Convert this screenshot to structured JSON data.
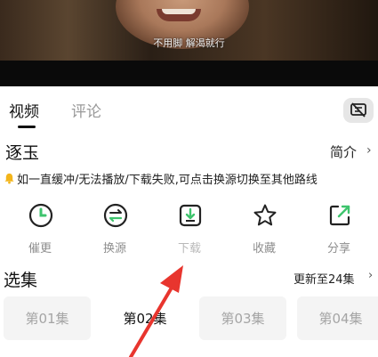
{
  "video": {
    "subtitle": "不用脚 解渴就行"
  },
  "tabs": [
    {
      "label": "视频",
      "active": true
    },
    {
      "label": "评论",
      "active": false
    }
  ],
  "danmu_button": {
    "icon": "danmaku-off-icon"
  },
  "show": {
    "title": "逐玉",
    "intro_label": "简介",
    "intro_arrow": "›"
  },
  "notice": {
    "icon": "bell-icon",
    "text": "如一直缓冲/无法播放/下载失败,可点击换源切换至其他路线"
  },
  "actions": [
    {
      "label": "催更",
      "icon": "clock-icon"
    },
    {
      "label": "换源",
      "icon": "switch-source-icon"
    },
    {
      "label": "下载",
      "icon": "download-icon"
    },
    {
      "label": "收藏",
      "icon": "star-icon"
    },
    {
      "label": "分享",
      "icon": "share-icon"
    }
  ],
  "episodes": {
    "title": "选集",
    "update_text": "更新至24集",
    "update_arrow": "›",
    "items": [
      {
        "label": "第01集",
        "current": false
      },
      {
        "label": "第02集",
        "current": true
      },
      {
        "label": "第03集",
        "current": false
      },
      {
        "label": "第04集",
        "current": false
      }
    ]
  },
  "colors": {
    "accent_green": "#3ec46d",
    "annotation_red": "#e8352e",
    "muted_text": "#8e8e8e"
  }
}
